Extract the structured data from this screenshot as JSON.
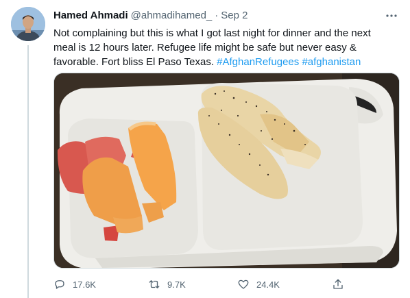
{
  "user": {
    "name": "Hamed Ahmadi",
    "handle": "@ahmadihamed_",
    "separator": "·",
    "date": "Sep 2"
  },
  "tweet": {
    "text": "Not complaining but this is what I got last night for dinner and the next meal is 12 hours later. Refugee life might be safe but never easy & favorable. Fort bliss El Paso Texas.",
    "hashtags": [
      "#AfghanRefugees",
      "#afghanistan"
    ]
  },
  "media": {
    "icon": "photo"
  },
  "actions": {
    "replies": "17.6K",
    "retweets": "9.7K",
    "likes": "24.4K"
  },
  "colors": {
    "accent": "#1d9bf0",
    "secondary_text": "#536471",
    "divider": "#cfd9de"
  }
}
